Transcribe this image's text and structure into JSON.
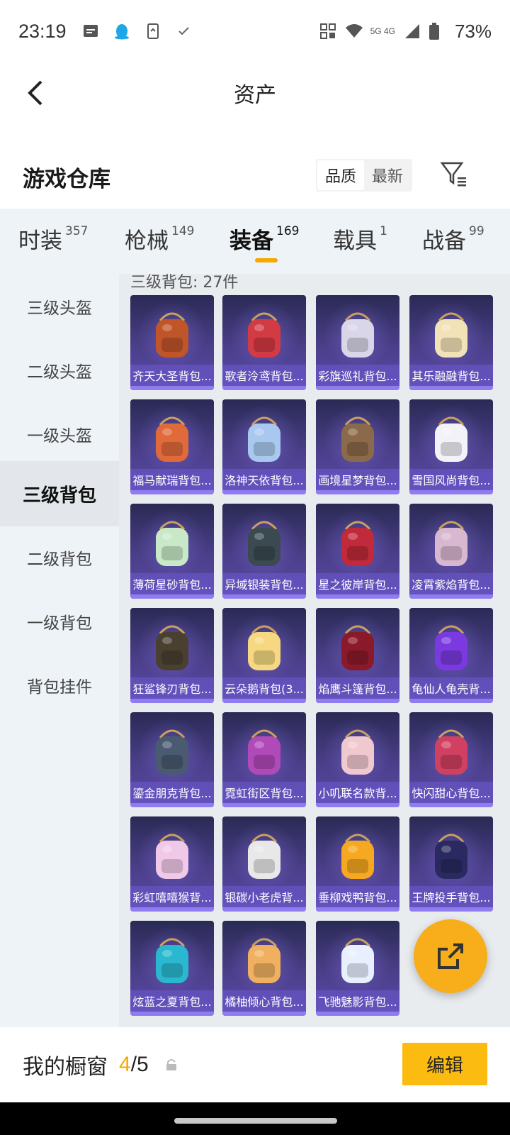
{
  "status_bar": {
    "time": "23:19",
    "network": "5G 4G",
    "battery": "73%",
    "icons": [
      "message-icon",
      "qq-penguin-icon",
      "phone-sync-icon",
      "check-icon",
      "nfc-icon",
      "wifi-icon",
      "signal-icon",
      "battery-icon"
    ]
  },
  "nav": {
    "title": "资产"
  },
  "warehouse": {
    "title": "游戏仓库",
    "sort_options": [
      "品质",
      "最新"
    ],
    "active_sort": "品质"
  },
  "categories": [
    {
      "label": "时装",
      "count": "357"
    },
    {
      "label": "枪械",
      "count": "149"
    },
    {
      "label": "装备",
      "count": "169",
      "active": true
    },
    {
      "label": "载具",
      "count": "1"
    },
    {
      "label": "战备",
      "count": "99"
    }
  ],
  "sidebar": {
    "items": [
      "三级头盔",
      "二级头盔",
      "一级头盔",
      "三级背包",
      "二级背包",
      "一级背包",
      "背包挂件"
    ],
    "active_index": 3
  },
  "section": {
    "title": "三级背包: 27件"
  },
  "items": [
    "齐天大圣背包...",
    "歌者泠鸢背包...",
    "彩旗巡礼背包...",
    "其乐融融背包...",
    "福马献瑞背包...",
    "洛神天依背包...",
    "画境星梦背包...",
    "雪国风尚背包...",
    "薄荷星砂背包...",
    "异域银装背包...",
    "星之彼岸背包...",
    "凌霄紫焰背包...",
    "狂鲨锋刃背包...",
    "云朵鹅背包(3...",
    "焰鹰斗篷背包...",
    "龟仙人龟壳背...",
    "鎏金朋克背包...",
    "霓虹街区背包...",
    "小叽联名款背...",
    "快闪甜心背包...",
    "彩虹嘻嘻猴背...",
    "银碳小老虎背...",
    "垂柳戏鸭背包...",
    "王牌投手背包...",
    "炫蓝之夏背包...",
    "橘柚倾心背包...",
    "飞驰魅影背包..."
  ],
  "item_colors": [
    "#c0552a",
    "#d23a44",
    "#d8d6e8",
    "#f2e2b8",
    "#e06a3a",
    "#a9c8f0",
    "#8a6a4a",
    "#f2f2f8",
    "#c8e8c8",
    "#3a4a50",
    "#c02a3a",
    "#d8b8d0",
    "#4a4030",
    "#f5d880",
    "#8a1a2a",
    "#7a3ae0",
    "#4a5a70",
    "#b04ab8",
    "#f0c8d0",
    "#d04060",
    "#f0c8e8",
    "#e8e8e8",
    "#f5a820",
    "#2a2a60",
    "#2ab8d0",
    "#f0b060",
    "#e8f0ff"
  ],
  "bottom": {
    "window_label": "我的橱窗",
    "window_current": "4",
    "window_total": "/5",
    "edit_label": "编辑"
  }
}
